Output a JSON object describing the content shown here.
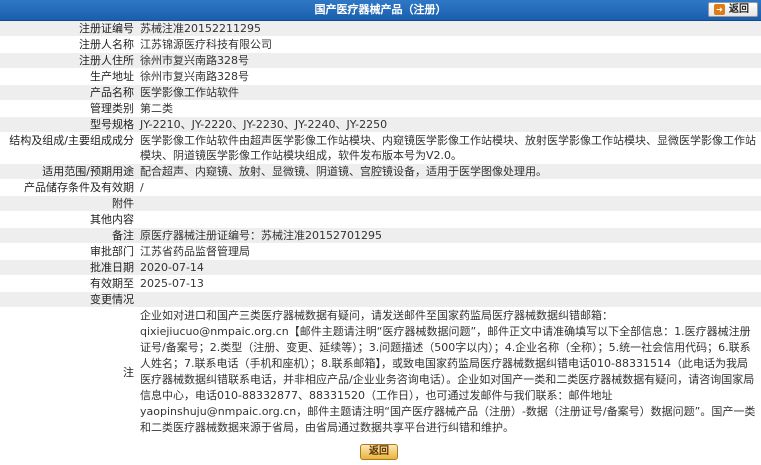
{
  "header": {
    "title": "国产医疗器械产品（注册）",
    "back_label": "返回"
  },
  "fields": [
    {
      "label": "注册证编号",
      "value": "苏械注准20152211295"
    },
    {
      "label": "注册人名称",
      "value": "江苏锦源医疗科技有限公司"
    },
    {
      "label": "注册人住所",
      "value": "徐州市复兴南路328号"
    },
    {
      "label": "生产地址",
      "value": "徐州市复兴南路328号"
    },
    {
      "label": "产品名称",
      "value": "医学影像工作站软件"
    },
    {
      "label": "管理类别",
      "value": "第二类"
    },
    {
      "label": "型号规格",
      "value": "JY-2210、JY-2220、JY-2230、JY-2240、JY-2250"
    },
    {
      "label": "结构及组成/主要组成成分",
      "value": "医学影像工作站软件由超声医学影像工作站模块、内窥镜医学影像工作站模块、放射医学影像工作站模块、显微医学影像工作站模块、阴道镜医学影像工作站模块组成，软件发布版本号为V2.0。"
    },
    {
      "label": "适用范围/预期用途",
      "value": "配合超声、内窥镜、放射、显微镜、阴道镜、宫腔镜设备，适用于医学图像处理用。"
    },
    {
      "label": "产品储存条件及有效期",
      "value": "/"
    },
    {
      "label": "附件",
      "value": ""
    },
    {
      "label": "其他内容",
      "value": ""
    },
    {
      "label": "备注",
      "value": "原医疗器械注册证编号：苏械注准20152701295"
    },
    {
      "label": "审批部门",
      "value": "江苏省药品监督管理局"
    },
    {
      "label": "批准日期",
      "value": "2020-07-14"
    },
    {
      "label": "有效期至",
      "value": "2025-07-13"
    },
    {
      "label": "变更情况",
      "value": ""
    },
    {
      "label": "注",
      "value": "企业如对进口和国产三类医疗器械数据有疑问，请发送邮件至国家药监局医疗器械数据纠错邮箱：qixiejiucuo@nmpaic.org.cn【邮件主题请注明“医疗器械数据问题”，邮件正文中请准确填写以下全部信息：1.医疗器械注册证号/备案号；2.类型（注册、变更、延续等）；3.问题描述（500字以内）；4.企业名称（全称）；5.统一社会信用代码；6.联系人姓名；7.联系电话（手机和座机）；8.联系邮箱】，或致电国家药监局医疗器械数据纠错电话010-88331514（此电话为我局医疗器械数据纠错联系电话，并非相应产品/企业业务咨询电话）。企业如对国产一类和二类医疗器械数据有疑问，请咨询国家局信息中心，电话010-88332877、88331520（工作日），也可通过发邮件与我们联系：邮件地址yaopinshuju@nmpaic.org.cn，邮件主题请注明“国产医疗器械产品（注册）-数据（注册证号/备案号）数据问题”。国产一类和二类医疗器械数据来源于省局，由省局通过数据共享平台进行纠错和维护。"
    }
  ],
  "footer": {
    "back_label": "返回"
  }
}
